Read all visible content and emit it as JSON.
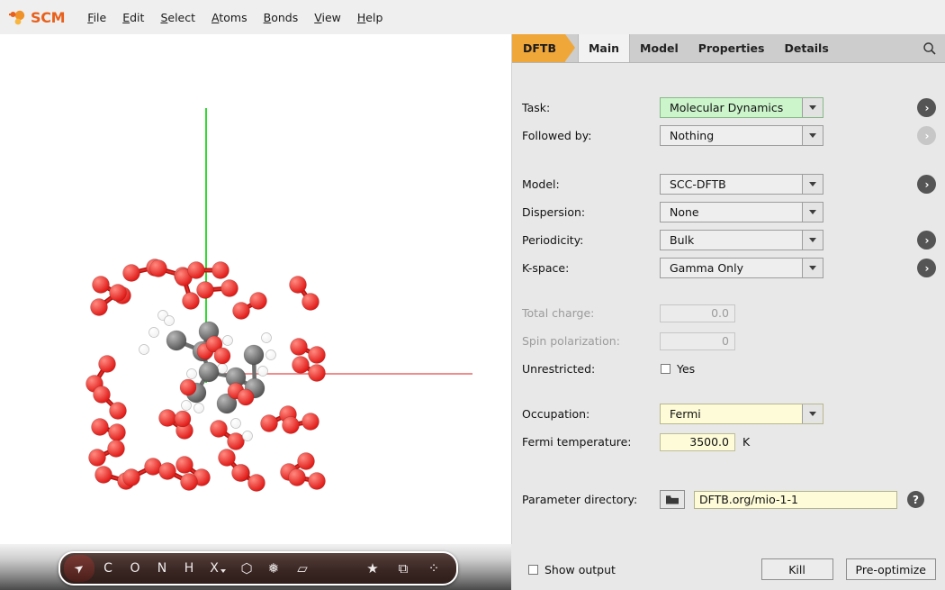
{
  "app": {
    "brand": "SCM",
    "menus": [
      {
        "mnemonic": "F",
        "rest": "ile",
        "name": "file"
      },
      {
        "mnemonic": "E",
        "rest": "dit",
        "name": "edit"
      },
      {
        "mnemonic": "S",
        "rest": "elect",
        "name": "select"
      },
      {
        "mnemonic": "A",
        "rest": "toms",
        "name": "atoms"
      },
      {
        "mnemonic": "B",
        "rest": "onds",
        "name": "bonds"
      },
      {
        "mnemonic": "V",
        "rest": "iew",
        "name": "view"
      },
      {
        "mnemonic": "H",
        "rest": "elp",
        "name": "help"
      }
    ]
  },
  "tabs": {
    "module": "DFTB",
    "items": [
      {
        "label": "Main",
        "active": true
      },
      {
        "label": "Model",
        "active": false
      },
      {
        "label": "Properties",
        "active": false
      },
      {
        "label": "Details",
        "active": false
      }
    ],
    "search_icon": "search-icon"
  },
  "form": {
    "task": {
      "label": "Task:",
      "value": "Molecular Dynamics",
      "state": "changed",
      "arrow": "enabled"
    },
    "followed_by": {
      "label": "Followed by:",
      "value": "Nothing",
      "state": "default",
      "arrow": "disabled"
    },
    "model": {
      "label": "Model:",
      "value": "SCC-DFTB",
      "state": "default",
      "arrow": "enabled"
    },
    "dispersion": {
      "label": "Dispersion:",
      "value": "None",
      "state": "default",
      "arrow": "none"
    },
    "periodicity": {
      "label": "Periodicity:",
      "value": "Bulk",
      "state": "default",
      "arrow": "enabled"
    },
    "kspace": {
      "label": "K-space:",
      "value": "Gamma Only",
      "state": "default",
      "arrow": "enabled"
    },
    "total_charge": {
      "label": "Total charge:",
      "value": "0.0",
      "disabled": true
    },
    "spin_polarization": {
      "label": "Spin polarization:",
      "value": "0",
      "disabled": true
    },
    "unrestricted": {
      "label": "Unrestricted:",
      "checkbox_label": "Yes",
      "checked": false
    },
    "occupation": {
      "label": "Occupation:",
      "value": "Fermi",
      "state": "changed-yellow"
    },
    "fermi_temperature": {
      "label": "Fermi temperature:",
      "value": "3500.0",
      "unit": "K",
      "state": "changed-yellow"
    },
    "parameter_directory": {
      "label": "Parameter directory:",
      "value": "DFTB.org/mio-1-1",
      "folder_icon": "folder-icon",
      "help_label": "?"
    }
  },
  "footer": {
    "show_output": {
      "label": "Show output",
      "checked": false
    },
    "kill_label": "Kill",
    "preoptimize_label": "Pre-optimize"
  },
  "toolbar": {
    "tools": [
      {
        "glyph": "➤",
        "name": "select-cursor-tool",
        "selected": true
      },
      {
        "glyph": "C",
        "name": "carbon-tool",
        "selected": false
      },
      {
        "glyph": "O",
        "name": "oxygen-tool",
        "selected": false
      },
      {
        "glyph": "N",
        "name": "nitrogen-tool",
        "selected": false
      },
      {
        "glyph": "H",
        "name": "hydrogen-tool",
        "selected": false
      },
      {
        "glyph": "X",
        "name": "other-element-tool",
        "selected": false,
        "dropdown": true
      },
      {
        "glyph": "⬡",
        "name": "ring-tool",
        "selected": false
      },
      {
        "glyph": "❅",
        "name": "snowflake-tool",
        "selected": false
      },
      {
        "glyph": "▱",
        "name": "plane-tool",
        "selected": false
      },
      {
        "glyph": "★",
        "name": "favorites-tool",
        "selected": false
      },
      {
        "glyph": "⧉",
        "name": "unit-cell-tool",
        "selected": false
      },
      {
        "glyph": "⁘",
        "name": "points-tool",
        "selected": false
      }
    ]
  },
  "viewport": {
    "axis_vertical_color": "#2fdb2f",
    "axis_horizontal_color": "#f08c8c",
    "atom_colors": {
      "oxygen": "#e01b18",
      "carbon": "#585858",
      "hydrogen": "#f2f2f2"
    },
    "structure_label": "molecular-structure"
  },
  "colors": {
    "accent_orange": "#f0a73a",
    "brand_orange": "#e8601c",
    "changed_green": "#ccf5cc",
    "changed_yellow": "#fdfbd8",
    "panel_bg": "#e8e8e8"
  }
}
